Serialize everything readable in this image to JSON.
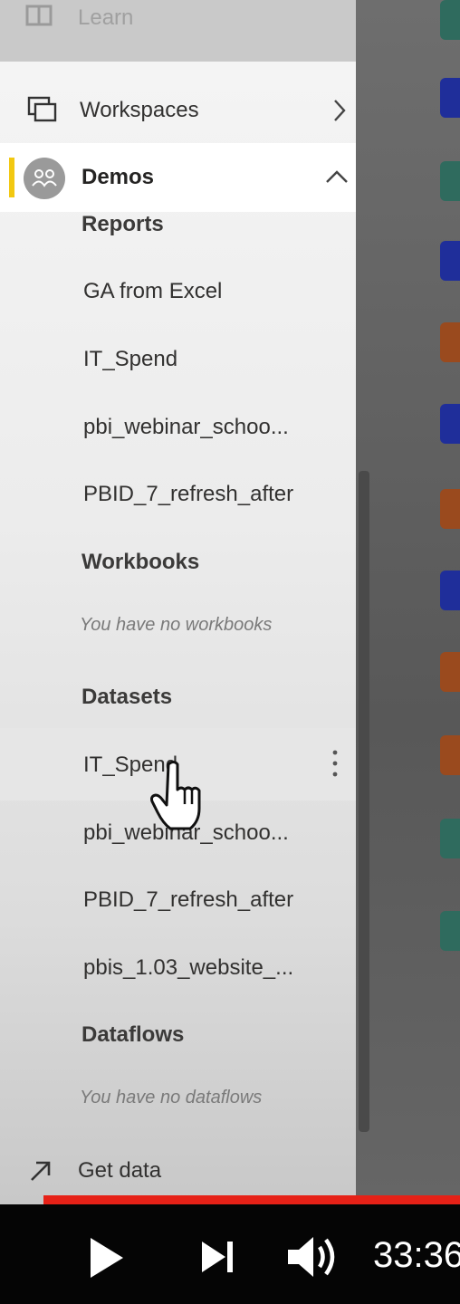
{
  "top": {
    "learn_label": "Learn"
  },
  "nav": {
    "workspaces_label": "Workspaces",
    "active_workspace": "Demos",
    "accent_color": "#f2c811"
  },
  "sections": {
    "reports": {
      "heading": "Reports",
      "items": [
        "GA from Excel",
        "IT_Spend",
        "pbi_webinar_schoo...",
        "PBID_7_refresh_after"
      ]
    },
    "workbooks": {
      "heading": "Workbooks",
      "empty_text": "You have no workbooks"
    },
    "datasets": {
      "heading": "Datasets",
      "items": [
        "IT_Spend",
        "pbi_webinar_schoo...",
        "PBID_7_refresh_after",
        "pbis_1.03_website_..."
      ]
    },
    "dataflows": {
      "heading": "Dataflows",
      "empty_text": "You have no dataflows"
    }
  },
  "footer": {
    "get_data_label": "Get data"
  },
  "player": {
    "time": "33:36",
    "progress_color": "#e62117",
    "icons": [
      "play-icon",
      "next-icon",
      "volume-icon"
    ]
  }
}
